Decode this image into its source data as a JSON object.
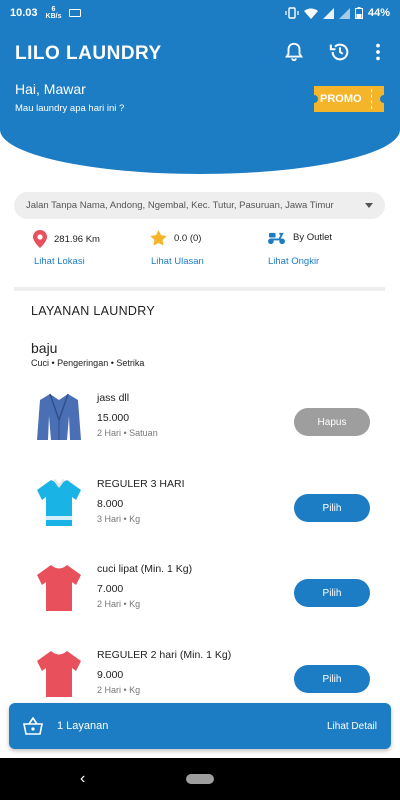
{
  "status_bar": {
    "time": "10.03",
    "speed_value": "6",
    "speed_unit": "KB/s",
    "battery": "44%"
  },
  "header": {
    "title": "LILO LAUNDRY",
    "greeting": "Hai, Mawar",
    "subtitle": "Mau laundry apa hari ini ?",
    "promo_label": "PROMO"
  },
  "location": {
    "address": "Jalan Tanpa Nama, Andong, Ngembal, Kec. Tutur, Pasuruan, Jawa Timur",
    "distance": "281.96 Km",
    "distance_link": "Lihat Lokasi",
    "rating": "0.0 (0)",
    "rating_link": "Lihat Ulasan",
    "delivery": "By Outlet",
    "delivery_link": "Lihat Ongkir"
  },
  "services": {
    "section_title": "LAYANAN LAUNDRY",
    "category": "baju",
    "category_subtitle": "Cuci • Pengeringan • Setrika",
    "items": [
      {
        "name": "jass dll",
        "price": "15.000",
        "duration": "2 Hari",
        "unit": "Satuan",
        "button": "Hapus",
        "state": "selected"
      },
      {
        "name": "REGULER 3 HARI",
        "price": "8.000",
        "duration": "3 Hari",
        "unit": "Kg",
        "button": "Pilih",
        "state": "available"
      },
      {
        "name": "cuci lipat (Min. 1 Kg)",
        "price": "7.000",
        "duration": "2 Hari",
        "unit": "Kg",
        "button": "Pilih",
        "state": "available"
      },
      {
        "name": "REGULER 2 hari (Min. 1 Kg)",
        "price": "9.000",
        "duration": "2 Hari",
        "unit": "Kg",
        "button": "Pilih",
        "state": "available"
      }
    ]
  },
  "cart": {
    "count_label": "1 Layanan",
    "detail_label": "Lihat Detail"
  },
  "colors": {
    "primary": "#1d7dc4",
    "promo": "#f5b52b",
    "disabled": "#9e9e9e",
    "jacket": "#4a6fb5",
    "shirt_cyan": "#1ab3e6",
    "shirt_red": "#e8505b"
  },
  "icons": {
    "header": [
      "bell-icon",
      "history-icon",
      "more-vertical-icon"
    ],
    "info": [
      "location-pin-icon",
      "star-icon",
      "scooter-icon"
    ],
    "cart": "basket-icon"
  }
}
